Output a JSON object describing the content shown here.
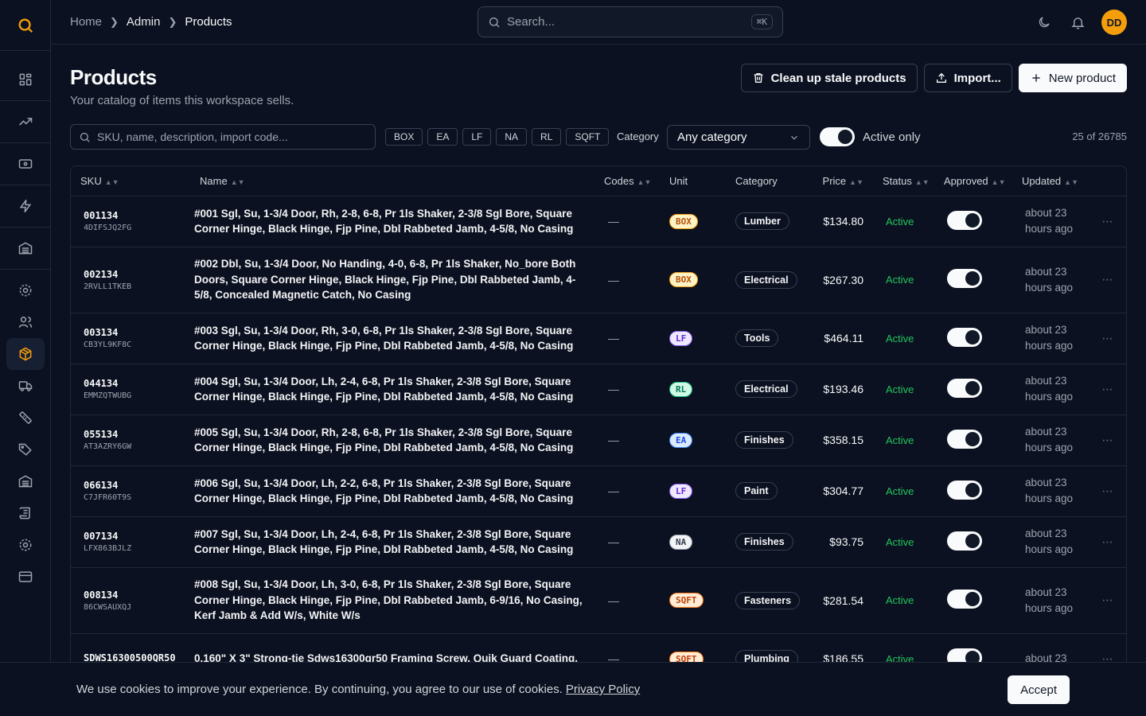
{
  "colors": {
    "accent": "#f59e0b",
    "status_active": "#22c55e"
  },
  "breadcrumb": [
    "Home",
    "Admin",
    "Products"
  ],
  "search": {
    "placeholder": "Search...",
    "shortcut": "⌘K"
  },
  "user": {
    "initials": "DD"
  },
  "page": {
    "title": "Products",
    "subtitle": "Your catalog of items this workspace sells."
  },
  "actions": {
    "cleanup": "Clean up stale products",
    "import": "Import...",
    "new": "New product"
  },
  "filters": {
    "search_placeholder": "SKU, name, description, import code...",
    "units": [
      "BOX",
      "EA",
      "LF",
      "NA",
      "RL",
      "SQFT"
    ],
    "category_label": "Category",
    "category_value": "Any category",
    "active_only_label": "Active only",
    "count": "25 of 26785"
  },
  "table": {
    "headers": [
      "SKU",
      "Name",
      "Codes",
      "Unit",
      "Category",
      "Price",
      "Status",
      "Approved",
      "Updated"
    ],
    "rows": [
      {
        "sku": "001134",
        "code": "4DIFSJQ2FG",
        "name": "#001 Sgl, Su, 1-3/4 Door, Rh, 2-8, 6-8, Pr 1ls Shaker, 2-3/8 Sgl Bore, Square Corner Hinge, Black Hinge, Fjp Pine, Dbl Rabbeted Jamb, 4-5/8, No Casing",
        "codes": "—",
        "unit": "BOX",
        "category": "Lumber",
        "price": "$134.80",
        "status": "Active",
        "updated": "about 23 hours ago"
      },
      {
        "sku": "002134",
        "code": "2RVLL1TKEB",
        "name": "#002 Dbl, Su, 1-3/4 Door, No Handing, 4-0, 6-8, Pr 1ls Shaker, No_bore Both Doors, Square Corner Hinge, Black Hinge, Fjp Pine, Dbl Rabbeted Jamb, 4-5/8, Concealed Magnetic Catch, No Casing",
        "codes": "—",
        "unit": "BOX",
        "category": "Electrical",
        "price": "$267.30",
        "status": "Active",
        "updated": "about 23 hours ago"
      },
      {
        "sku": "003134",
        "code": "CB3YL9KF8C",
        "name": "#003 Sgl, Su, 1-3/4 Door, Rh, 3-0, 6-8, Pr 1ls Shaker, 2-3/8 Sgl Bore, Square Corner Hinge, Black Hinge, Fjp Pine, Dbl Rabbeted Jamb, 4-5/8, No Casing",
        "codes": "—",
        "unit": "LF",
        "category": "Tools",
        "price": "$464.11",
        "status": "Active",
        "updated": "about 23 hours ago"
      },
      {
        "sku": "044134",
        "code": "EMMZQTWUBG",
        "name": "#004 Sgl, Su, 1-3/4 Door, Lh, 2-4, 6-8, Pr 1ls Shaker, 2-3/8 Sgl Bore, Square Corner Hinge, Black Hinge, Fjp Pine, Dbl Rabbeted Jamb, 4-5/8, No Casing",
        "codes": "—",
        "unit": "RL",
        "category": "Electrical",
        "price": "$193.46",
        "status": "Active",
        "updated": "about 23 hours ago"
      },
      {
        "sku": "055134",
        "code": "AT3AZRY6GW",
        "name": "#005 Sgl, Su, 1-3/4 Door, Rh, 2-8, 6-8, Pr 1ls Shaker, 2-3/8 Sgl Bore, Square Corner Hinge, Black Hinge, Fjp Pine, Dbl Rabbeted Jamb, 4-5/8, No Casing",
        "codes": "—",
        "unit": "EA",
        "category": "Finishes",
        "price": "$358.15",
        "status": "Active",
        "updated": "about 23 hours ago"
      },
      {
        "sku": "066134",
        "code": "C7JFR60T9S",
        "name": "#006 Sgl, Su, 1-3/4 Door, Lh, 2-2, 6-8, Pr 1ls Shaker, 2-3/8 Sgl Bore, Square Corner Hinge, Black Hinge, Fjp Pine, Dbl Rabbeted Jamb, 4-5/8, No Casing",
        "codes": "—",
        "unit": "LF",
        "category": "Paint",
        "price": "$304.77",
        "status": "Active",
        "updated": "about 23 hours ago"
      },
      {
        "sku": "007134",
        "code": "LFX863BJLZ",
        "name": "#007 Sgl, Su, 1-3/4 Door, Lh, 2-4, 6-8, Pr 1ls Shaker, 2-3/8 Sgl Bore, Square Corner Hinge, Black Hinge, Fjp Pine, Dbl Rabbeted Jamb, 4-5/8, No Casing",
        "codes": "—",
        "unit": "NA",
        "category": "Finishes",
        "price": "$93.75",
        "status": "Active",
        "updated": "about 23 hours ago"
      },
      {
        "sku": "008134",
        "code": "86CWSAUXQJ",
        "name": "#008 Sgl, Su, 1-3/4 Door, Lh, 3-0, 6-8, Pr 1ls Shaker, 2-3/8 Sgl Bore, Square Corner Hinge, Black Hinge, Fjp Pine, Dbl Rabbeted Jamb, 6-9/16, No Casing, Kerf Jamb & Add W/s, White W/s",
        "codes": "—",
        "unit": "SQFT",
        "category": "Fasteners",
        "price": "$281.54",
        "status": "Active",
        "updated": "about 23 hours ago"
      },
      {
        "sku": "SDWS16300500QR50",
        "code": "",
        "name": "0.160\" X 3\" Strong-tie Sdws16300qr50 Framing Screw, Quik Guard Coating,",
        "codes": "—",
        "unit": "SQFT",
        "category": "Plumbing",
        "price": "$186.55",
        "status": "Active",
        "updated": "about 23"
      }
    ]
  },
  "unit_colors": {
    "BOX": {
      "bg": "#fef3c7",
      "fg": "#b45309",
      "border": "#f59e0b"
    },
    "LF": {
      "bg": "#ede9fe",
      "fg": "#6d28d9",
      "border": "#8b5cf6"
    },
    "RL": {
      "bg": "#d1fae5",
      "fg": "#047857",
      "border": "#10b981"
    },
    "EA": {
      "bg": "#dbeafe",
      "fg": "#1d4ed8",
      "border": "#3b82f6"
    },
    "NA": {
      "bg": "#f3f4f6",
      "fg": "#374151",
      "border": "#9ca3af"
    },
    "SQFT": {
      "bg": "#ffedd5",
      "fg": "#c2410c",
      "border": "#f97316"
    }
  },
  "cookie": {
    "text": "We use cookies to improve your experience. By continuing, you agree to our use of cookies.",
    "link": "Privacy Policy",
    "accept": "Accept"
  }
}
